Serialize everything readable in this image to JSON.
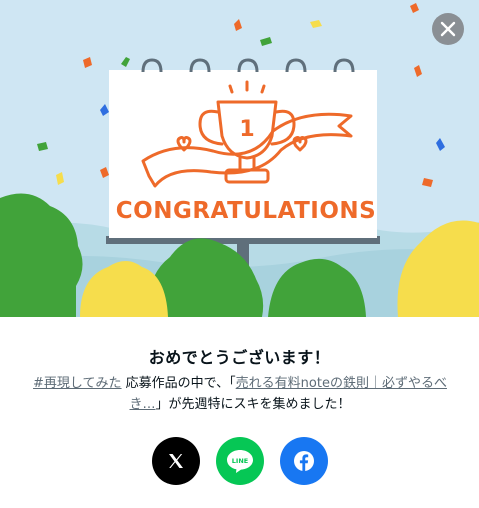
{
  "illustration": {
    "banner_text": "CONGRATULATIONS",
    "trophy_number": "1",
    "colors": {
      "sky": "#cfe6f3",
      "accent_orange": "#ee6a2a",
      "bush_green": "#41a33a",
      "bush_yellow": "#f6dd4c",
      "billboard_post": "#5f6f7b"
    }
  },
  "modal": {
    "title": "おめでとうございます！",
    "message": {
      "hashtag": "#再現してみた",
      "part1": " 応募作品の中で、「",
      "article_link": "売れる有料noteの鉄則｜必ずやるべき…",
      "part2": "」が先週特にスキを集めました！"
    }
  },
  "share": {
    "x_icon": "x-logo-icon",
    "line_label": "LINE",
    "line_icon": "line-logo-icon",
    "facebook_icon": "facebook-logo-icon"
  },
  "close_icon": "close-icon"
}
